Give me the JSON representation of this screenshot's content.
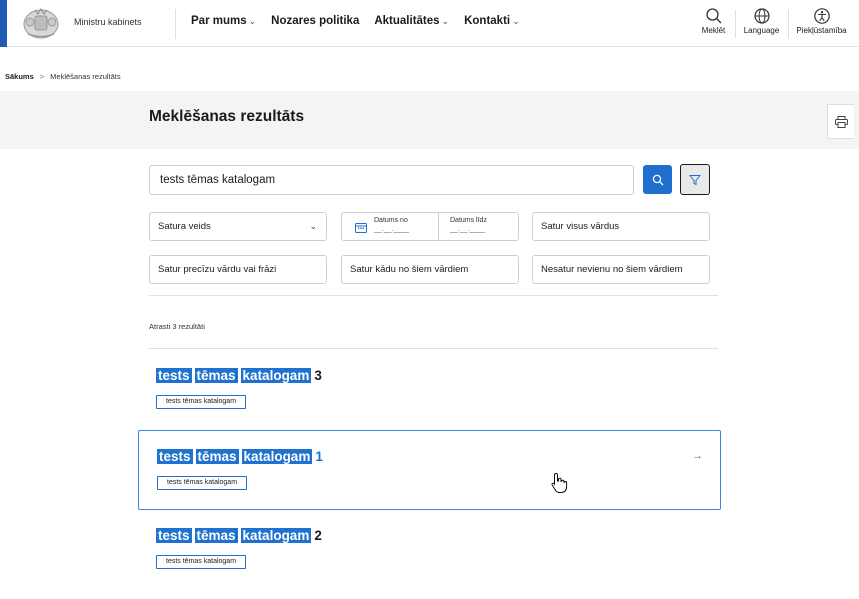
{
  "header": {
    "logo_text": "Ministru kabinets",
    "nav": [
      {
        "label": "Par mums",
        "dropdown": true
      },
      {
        "label": "Nozares politika",
        "dropdown": false
      },
      {
        "label": "Aktualitātes",
        "dropdown": true
      },
      {
        "label": "Kontakti",
        "dropdown": true
      }
    ],
    "search_label": "Meklēt",
    "language_label": "Language",
    "accessibility_label": "Piekļūstamība",
    "accent_color": "#1f5bb4"
  },
  "breadcrumb": {
    "home": "Sākums",
    "separator": ">",
    "current": "Meklēšanas rezultāts"
  },
  "page": {
    "title": "Meklēšanas rezultāts"
  },
  "search": {
    "value": "tests tēmas katalogam",
    "button_color": "#1f6fcf"
  },
  "filters": {
    "content_type": "Satura veids",
    "date_from_label": "Datums no",
    "date_from_value": "__.__.____",
    "date_to_label": "Datums līdz",
    "date_to_value": "__.__.____",
    "all_words": "Satur visus vārdus",
    "exact_phrase": "Satur precīzu vārdu vai frāzi",
    "any_words": "Satur kādu no šiem vārdiem",
    "none_words": "Nesatur nevienu no šiem vārdiem"
  },
  "results_count": "Atrasti 3 rezultāti",
  "results": [
    {
      "words": [
        "tests",
        "tēmas",
        "katalogam"
      ],
      "number": "3",
      "tag": "tests tēmas katalogam"
    },
    {
      "words": [
        "tests",
        "tēmas",
        "katalogam"
      ],
      "number": "1",
      "tag": "tests tēmas katalogam",
      "arrow": "→"
    },
    {
      "words": [
        "tests",
        "tēmas",
        "katalogam"
      ],
      "number": "2",
      "tag": "tests tēmas katalogam"
    }
  ]
}
